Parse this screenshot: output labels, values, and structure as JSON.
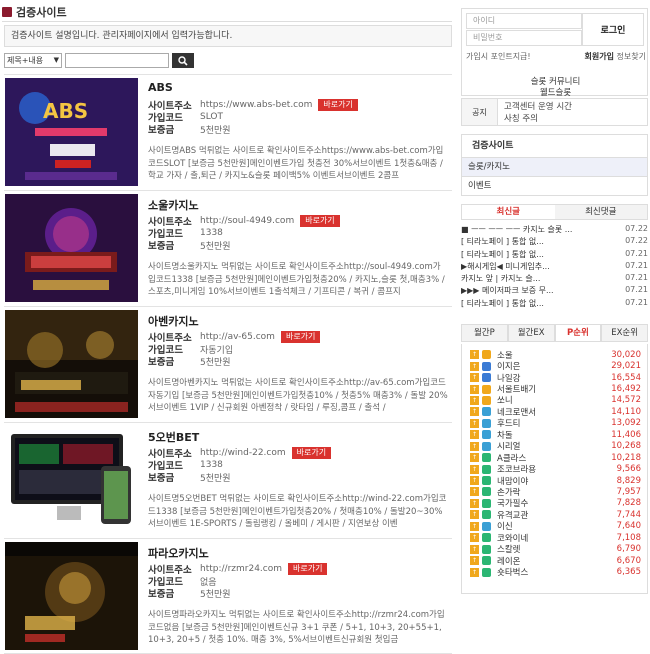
{
  "page": {
    "title": "검증사이트",
    "description": "검증사이트 설명입니다. 관리자페이지에서 입력가능합니다."
  },
  "search": {
    "select_value": "제목+내용",
    "input_value": ""
  },
  "labels": {
    "address": "사이트주소",
    "code": "가입코드",
    "deposit": "보증금",
    "go": "바로가기"
  },
  "sites": [
    {
      "name": "ABS",
      "url": "https://www.abs-bet.com",
      "code": "SLOT",
      "deposit": "5천만원",
      "desc": "사이트명ABS 먹튀없는 사이트로 확인사이트주소https://www.abs-bet.com가입코드SLOT [보증금 5천만원]메인이벤트가입 첫충전 30%서브이벤트 1첫충&매충 / 학교 가자 / 출,퇴근 / 카지노&슬롯 페이백5% 이벤트서브이벤트 2콤프"
    },
    {
      "name": "소울카지노",
      "url": "http://soul-4949.com",
      "code": "1338",
      "deposit": "5천만원",
      "desc": "사이트명소울카지노 먹튀없는 사이트로 확인사이트주소http://soul-4949.com가입코드1338 [보증금 5천만원]메인이벤트가입첫충20% / 카지노,슬롯 첫,매충3% / 스포츠,미니게임 10%서브이벤트 1출석체크 / 기프티콘 / 복귀 / 콤프지"
    },
    {
      "name": "아벤카지노",
      "url": "http://av-65.com",
      "code": "자동기입",
      "deposit": "5천만원",
      "desc": "사이트명아벤카지노 먹튀없는 사이트로 확인사이트주소http://av-65.com가입코드자동기입 [보증금 5천만원]메인이벤트가입첫충10% / 첫충5% 매충3% / 돌발 20%서브이벤트 1VIP / 신규회원 아벤정착 / 랏타임 / 루징,콤프 / 출석 /"
    },
    {
      "name": "5오번BET",
      "url": "http://wind-22.com",
      "code": "1338",
      "deposit": "5천만원",
      "desc": "사이트명5오번BET 먹튀없는 사이트로 확인사이트주소http://wind-22.com가입코드1338 [보증금 5천만원]메인이벤트가입첫충20% / 첫매충10% / 돌발20~30%서브이벤트 1E-SPORTS / 돌림랭킹 / 올베미 / 게시판 / 지연보상 이벤"
    },
    {
      "name": "파라오카지노",
      "url": "http://rzmr24.com",
      "code": "없음",
      "deposit": "5천만원",
      "desc": "사이트명파라오카지노 먹튀없는 사이트로 확인사이트주소http://rzmr24.com가입코드없음 [보증금 5천만원]메인이벤트신규 3+1 쿠폰 / 5+1, 10+3, 20+55+1, 10+3, 20+5 / 첫충 10%. 매충 3%, 5%서브이벤트신규회원 첫입금"
    }
  ],
  "sidebar": {
    "login": {
      "id_placeholder": "아이디",
      "pw_placeholder": "비밀번호",
      "login_button": "로그인",
      "point_link": "가입시 포인트지급!",
      "join_link": "회원가입",
      "find_link": "정보찾기",
      "community_line1": "슬롯 커뮤니티",
      "community_line2": "웰드슬롯"
    },
    "notice": {
      "label": "공지",
      "line1": "고객센터 운영 시간",
      "line2": "사칭 주의"
    },
    "menu": {
      "head": "검증사이트",
      "items": [
        "슬롯/카지노",
        "이벤트"
      ]
    },
    "post_tabs": [
      "최신글",
      "최신댓글"
    ],
    "posts": [
      {
        "title": "■ ㅡㅡ ㅡㅡ ㅡㅡ 카지노 슬롯 ...",
        "date": "07.22"
      },
      {
        "title": "[ 티라노페이 ] 통합 없...",
        "date": "07.22"
      },
      {
        "title": "[ 티라노페이 ] 통합 없...",
        "date": "07.21"
      },
      {
        "title": "▶해시게임◀ 미니게임추...",
        "date": "07.21"
      },
      {
        "title": "카지노 앞 | 카지노 슬...",
        "date": "07.21"
      },
      {
        "title": "▶▶▶ 메이저파크 보증 무...",
        "date": "07.21"
      },
      {
        "title": "[ 티라노페이 ] 통합 없...",
        "date": "07.21"
      }
    ],
    "rank_tabs": [
      "월간P",
      "월간EX",
      "P순위",
      "EX순위"
    ],
    "ranks": [
      {
        "name": "소울",
        "score": "30,020",
        "lv_color": "#f0a81c"
      },
      {
        "name": "이지은",
        "score": "29,021",
        "lv_color": "#3a7bd5"
      },
      {
        "name": "나일강",
        "score": "16,554",
        "lv_color": "#3a7bd5"
      },
      {
        "name": "서울트배기",
        "score": "16,492",
        "lv_color": "#f0a81c"
      },
      {
        "name": "쏘니",
        "score": "14,572",
        "lv_color": "#f0a81c"
      },
      {
        "name": "네크로맨서",
        "score": "14,110",
        "lv_color": "#3aa0d5"
      },
      {
        "name": "후드티",
        "score": "13,092",
        "lv_color": "#3aa0d5"
      },
      {
        "name": "차돌",
        "score": "11,406",
        "lv_color": "#3aa0d5"
      },
      {
        "name": "시리얼",
        "score": "10,268",
        "lv_color": "#3aa0d5"
      },
      {
        "name": "A클라스",
        "score": "10,218",
        "lv_color": "#2bb673"
      },
      {
        "name": "조코브라용",
        "score": "9,566",
        "lv_color": "#2bb673"
      },
      {
        "name": "내맘이야",
        "score": "8,829",
        "lv_color": "#2bb673"
      },
      {
        "name": "손가락",
        "score": "7,957",
        "lv_color": "#2bb673"
      },
      {
        "name": "국가필수",
        "score": "7,828",
        "lv_color": "#2bb673"
      },
      {
        "name": "유격교관",
        "score": "7,744",
        "lv_color": "#2bb673"
      },
      {
        "name": "이신",
        "score": "7,640",
        "lv_color": "#3aa0d5"
      },
      {
        "name": "코와이네",
        "score": "7,108",
        "lv_color": "#2bb673"
      },
      {
        "name": "스칼렛",
        "score": "6,790",
        "lv_color": "#2bb673"
      },
      {
        "name": "레이온",
        "score": "6,670",
        "lv_color": "#2bb673"
      },
      {
        "name": "숏타벅스",
        "score": "6,365",
        "lv_color": "#2bb673"
      }
    ]
  }
}
